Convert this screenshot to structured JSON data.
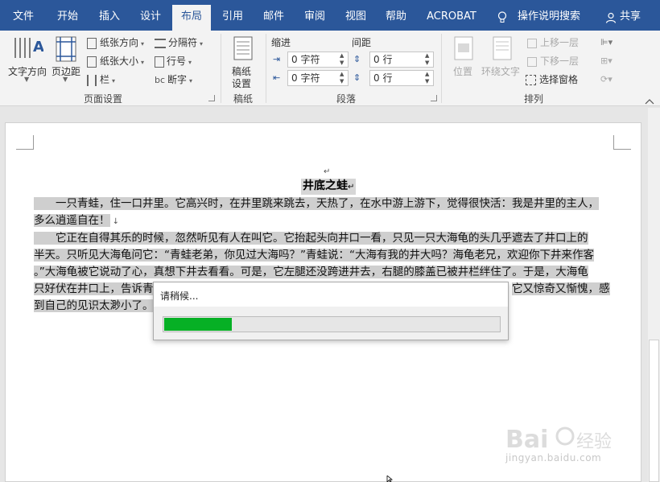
{
  "tabs": [
    {
      "label": "文件"
    },
    {
      "label": "开始"
    },
    {
      "label": "插入"
    },
    {
      "label": "设计"
    },
    {
      "label": "布局"
    },
    {
      "label": "引用"
    },
    {
      "label": "邮件"
    },
    {
      "label": "审阅"
    },
    {
      "label": "视图"
    },
    {
      "label": "帮助"
    },
    {
      "label": "ACROBAT"
    }
  ],
  "active_tab": "布局",
  "tell_me": "操作说明搜索",
  "share": "共享",
  "ribbon": {
    "page_setup": {
      "text_direction": "文字方向",
      "margins": "页边距",
      "orientation": "纸张方向",
      "size": "纸张大小",
      "columns": "栏",
      "breaks": "分隔符",
      "line_numbers": "行号",
      "hyphenation": "断字",
      "group": "页面设置"
    },
    "manuscript": {
      "button": "稿纸\n设置",
      "button_l1": "稿纸",
      "button_l2": "设置",
      "group": "稿纸"
    },
    "paragraph": {
      "indent_label": "缩进",
      "spacing_label": "间距",
      "indent_left": "0 字符",
      "indent_right": "0 字符",
      "spacing_before": "0 行",
      "spacing_after": "0 行",
      "group": "段落"
    },
    "arrange": {
      "position": "位置",
      "wrap_text": "环绕文字",
      "bring_forward": "上移一层",
      "send_backward": "下移一层",
      "selection_pane": "选择窗格",
      "group": "排列"
    }
  },
  "document": {
    "title": "井底之蛙",
    "lines": [
      "　　一只青蛙，住一口井里。它高兴时，在井里跳来跳去，天热了，在水中游上游下，觉得很快活：我是井里的主人，",
      "多么逍遥自在！",
      "　　它正在自得其乐的时候，忽然听见有人在叫它。它抬起头向井口一看，只见一只大海龟的头几乎遮去了井口上的",
      "半天。只听见大海龟问它：“青蛙老弟，你见过大海吗？”青蛙说：“大海有我的井大吗？海龟老兄，欢迎你下井来作客",
      "。”大海龟被它说动了心，真想下井去看看。可是，它左腿还没跨进井去，右腿的膝盖已被井栏绊住了。于是，大海龟",
      "只好伏在井口上，告诉青",
      "到自己的见识太渺小了。"
    ],
    "line6_tail": "它又惊奇又惭愧，感"
  },
  "dialog": {
    "title": "请稍候...",
    "progress": 0.2
  },
  "watermark": {
    "text": "jingyan.baidu.com"
  },
  "colors": {
    "tabbar": "#2b579a",
    "progress": "#06b025"
  }
}
